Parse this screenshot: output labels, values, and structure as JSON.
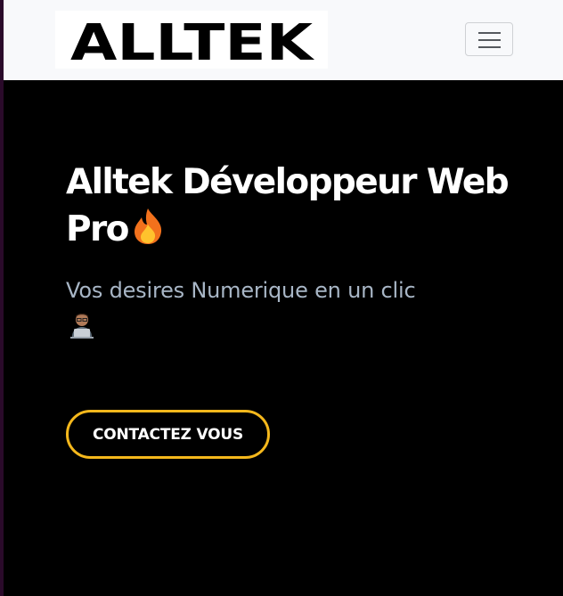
{
  "navbar": {
    "brand_text": "ALLTEK",
    "toggle_icon": "hamburger-menu-icon"
  },
  "hero": {
    "title": "Alltek Développeur Web Pro",
    "title_icon": "fire-emoji",
    "subtitle": "Vos desires Numerique en un clic",
    "subtitle_icon": "technologist-emoji",
    "cta_label": "CONTACTEZ VOUS"
  },
  "colors": {
    "background": "#000000",
    "navbar_bg": "#f8f9fb",
    "title": "#ffffff",
    "subtitle": "#a8b6c6",
    "cta_border": "#f5b81c"
  }
}
